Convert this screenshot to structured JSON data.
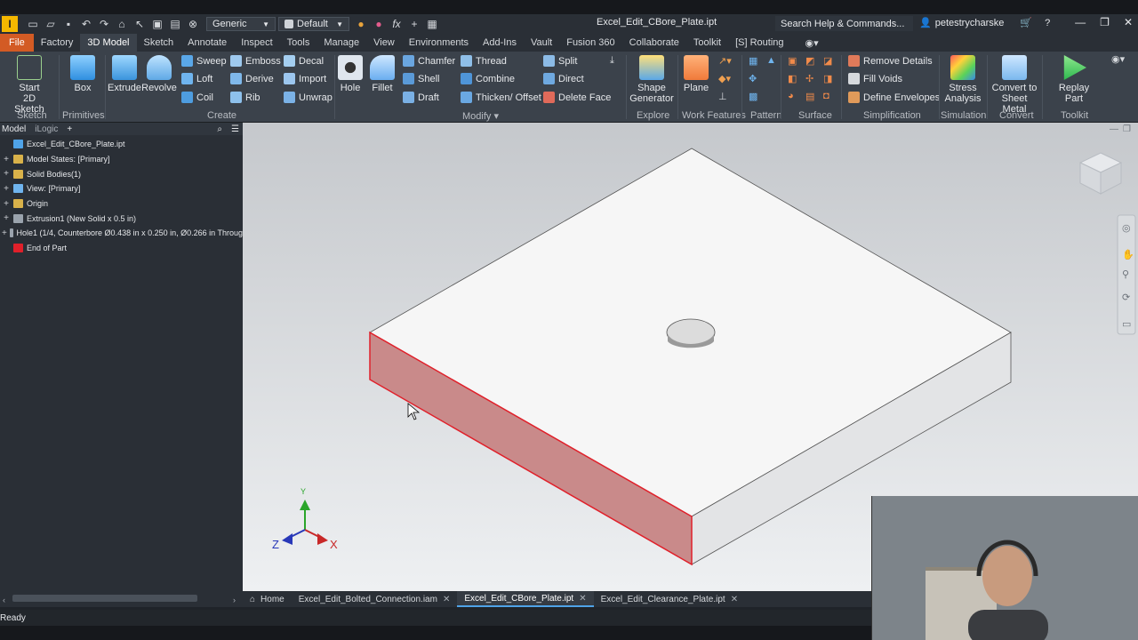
{
  "titlebar": {
    "app_logo": "I",
    "appearance_dropdown": "Generic",
    "style_dropdown": "Default",
    "doc_title": "Excel_Edit_CBore_Plate.ipt",
    "search_placeholder": "Search Help & Commands...",
    "user": "petestrycharske"
  },
  "menu": {
    "file": "File",
    "tabs": [
      "Factory",
      "3D Model",
      "Sketch",
      "Annotate",
      "Inspect",
      "Tools",
      "Manage",
      "View",
      "Environments",
      "Add-Ins",
      "Vault",
      "Fusion 360",
      "Collaborate",
      "Toolkit",
      "[S] Routing"
    ],
    "active": "3D Model"
  },
  "ribbon": {
    "start_sketch": "Start\n2D Sketch",
    "box": "Box",
    "extrude": "Extrude",
    "revolve": "Revolve",
    "sweep": "Sweep",
    "loft": "Loft",
    "coil": "Coil",
    "emboss": "Emboss",
    "derive": "Derive",
    "rib": "Rib",
    "decal": "Decal",
    "import": "Import",
    "unwrap": "Unwrap",
    "hole": "Hole",
    "fillet": "Fillet",
    "chamfer": "Chamfer",
    "shell": "Shell",
    "draft": "Draft",
    "thread": "Thread",
    "combine": "Combine",
    "thicken_offset": "Thicken/ Offset",
    "split": "Split",
    "direct": "Direct",
    "delete_face": "Delete Face",
    "shape_generator": "Shape\nGenerator",
    "plane": "Plane",
    "remove_details": "Remove Details",
    "fill_voids": "Fill Voids",
    "define_envelopes": "Define Envelopes",
    "stress_analysis": "Stress\nAnalysis",
    "convert_sheet_metal": "Convert to\nSheet Metal",
    "replay_part": "Replay Part",
    "panels": {
      "sketch": "Sketch",
      "primitives": "Primitives",
      "create": "Create",
      "modify": "Modify",
      "explore": "Explore",
      "work_features": "Work Features",
      "pattern": "Pattern",
      "surface": "Surface",
      "simplification": "Simplification",
      "simulation": "Simulation",
      "convert": "Convert",
      "toolkit": "Toolkit"
    }
  },
  "browser": {
    "tab_model": "Model",
    "tab_ilogic": "iLogic",
    "items": [
      {
        "label": "Excel_Edit_CBore_Plate.ipt",
        "plus": false
      },
      {
        "label": "Model States: [Primary]",
        "plus": true
      },
      {
        "label": "Solid Bodies(1)",
        "plus": true
      },
      {
        "label": "View: [Primary]",
        "plus": true
      },
      {
        "label": "Origin",
        "plus": true
      },
      {
        "label": "Extrusion1 (New Solid x 0.5 in)",
        "plus": true
      },
      {
        "label": "Hole1 (1/4, Counterbore Ø0.438 in x 0.250 in, Ø0.266 in Throug",
        "plus": true
      },
      {
        "label": "End of Part",
        "plus": false
      }
    ]
  },
  "axes": {
    "x": "X",
    "y": "Y",
    "z": "Z"
  },
  "doctabs": {
    "home": "Home",
    "tabs": [
      "Excel_Edit_Bolted_Connection.iam",
      "Excel_Edit_CBore_Plate.ipt",
      "Excel_Edit_Clearance_Plate.ipt"
    ],
    "active": "Excel_Edit_CBore_Plate.ipt"
  },
  "status": {
    "text": "Ready"
  },
  "colors": {
    "accent": "#d35b24",
    "highlight": "#e0202a"
  }
}
